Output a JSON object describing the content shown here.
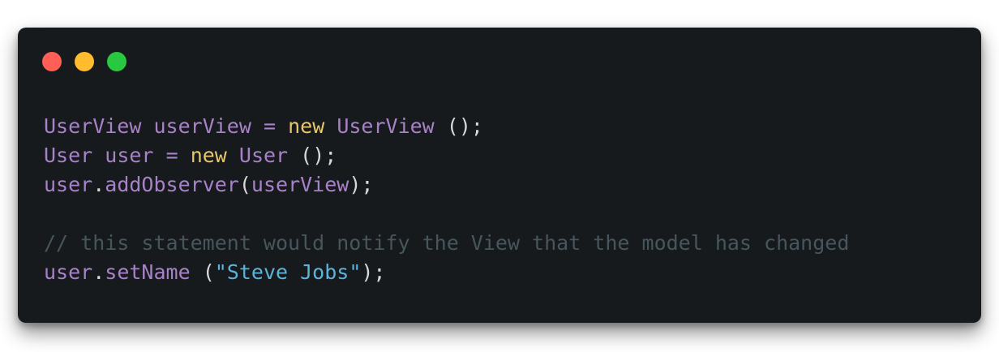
{
  "window": {
    "traffic_lights": {
      "close_color": "#ff5f57",
      "minimize_color": "#febc2e",
      "maximize_color": "#28c840"
    }
  },
  "code": {
    "lines": [
      {
        "tokens": [
          {
            "text": "UserView",
            "type": "ident"
          },
          {
            "text": " ",
            "type": "punc"
          },
          {
            "text": "userView",
            "type": "ident"
          },
          {
            "text": " ",
            "type": "punc"
          },
          {
            "text": "=",
            "type": "ident"
          },
          {
            "text": " ",
            "type": "punc"
          },
          {
            "text": "new",
            "type": "kw"
          },
          {
            "text": " ",
            "type": "punc"
          },
          {
            "text": "UserView",
            "type": "ident"
          },
          {
            "text": " ();",
            "type": "punc"
          }
        ]
      },
      {
        "tokens": [
          {
            "text": "User",
            "type": "ident"
          },
          {
            "text": " ",
            "type": "punc"
          },
          {
            "text": "user",
            "type": "ident"
          },
          {
            "text": " ",
            "type": "punc"
          },
          {
            "text": "=",
            "type": "ident"
          },
          {
            "text": " ",
            "type": "punc"
          },
          {
            "text": "new",
            "type": "kw"
          },
          {
            "text": " ",
            "type": "punc"
          },
          {
            "text": "User",
            "type": "ident"
          },
          {
            "text": " ();",
            "type": "punc"
          }
        ]
      },
      {
        "tokens": [
          {
            "text": "user",
            "type": "ident"
          },
          {
            "text": ".",
            "type": "punc"
          },
          {
            "text": "addObserver",
            "type": "ident"
          },
          {
            "text": "(",
            "type": "punc"
          },
          {
            "text": "userView",
            "type": "ident"
          },
          {
            "text": ");",
            "type": "punc"
          }
        ]
      },
      {
        "tokens": []
      },
      {
        "tokens": [
          {
            "text": "// this statement would notify the View that the model has changed",
            "type": "comment"
          }
        ]
      },
      {
        "tokens": [
          {
            "text": "user",
            "type": "ident"
          },
          {
            "text": ".",
            "type": "punc"
          },
          {
            "text": "setName",
            "type": "ident"
          },
          {
            "text": " (",
            "type": "punc"
          },
          {
            "text": "\"Steve Jobs\"",
            "type": "str"
          },
          {
            "text": ");",
            "type": "punc"
          }
        ]
      }
    ]
  }
}
